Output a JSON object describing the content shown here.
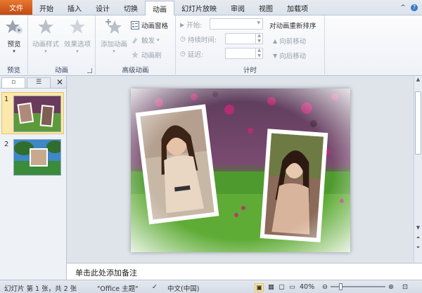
{
  "tabs": [
    {
      "label": "文件",
      "kind": "file"
    },
    {
      "label": "开始"
    },
    {
      "label": "插入"
    },
    {
      "label": "设计"
    },
    {
      "label": "切换"
    },
    {
      "label": "动画",
      "active": true
    },
    {
      "label": "幻灯片放映"
    },
    {
      "label": "审阅"
    },
    {
      "label": "视图"
    },
    {
      "label": "加载项"
    }
  ],
  "ribbon": {
    "preview": {
      "button": "预览",
      "group": "预览"
    },
    "animation": {
      "style_button": "动画样式",
      "effect_button": "效果选项",
      "group": "动画"
    },
    "advanced": {
      "add_button": "添加动画",
      "pane_button": "动画窗格",
      "trigger_button": "触发",
      "painter_button": "动画刷",
      "group": "高级动画"
    },
    "timing": {
      "start_label": "开始:",
      "duration_label": "持续时间:",
      "delay_label": "延迟:",
      "reorder_title": "对动画重新排序",
      "move_earlier": "向前移动",
      "move_later": "向后移动",
      "group": "计时"
    }
  },
  "slides": [
    {
      "number": "1",
      "selected": true
    },
    {
      "number": "2",
      "selected": false
    }
  ],
  "notes_placeholder": "单击此处添加备注",
  "status": {
    "slide_info": "幻灯片 第 1 张，共 2 张",
    "theme": "\"Office 主题\"",
    "language": "中文(中国)",
    "zoom": "40%"
  },
  "colors": {
    "file_tab": "#d2581a",
    "ribbon_border": "#b7c2d3",
    "selected_thumb": "#f2c664"
  }
}
